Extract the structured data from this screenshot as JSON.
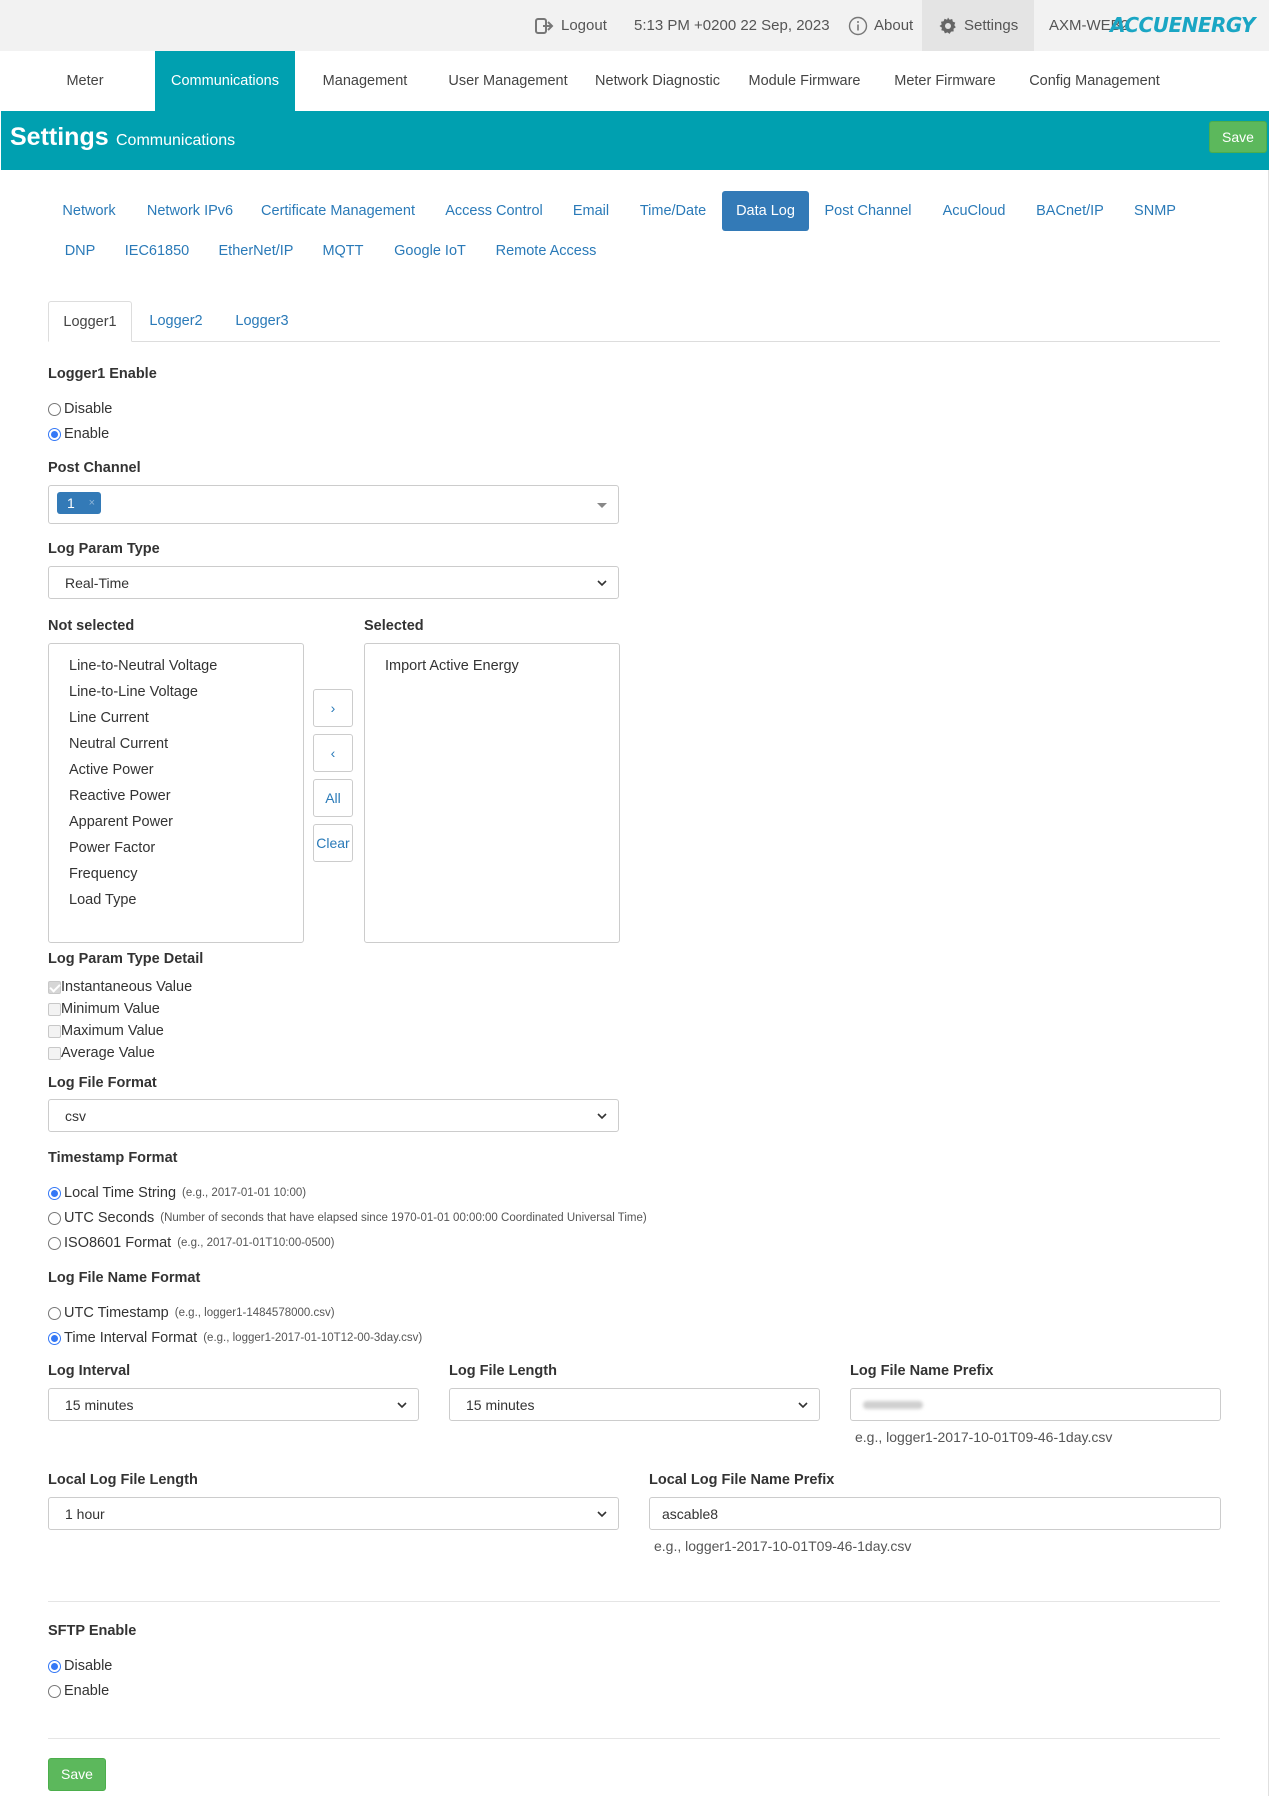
{
  "topbar": {
    "logout": "Logout",
    "datetime": "5:13 PM +0200 22 Sep, 2023",
    "about": "About",
    "settings": "Settings",
    "device": "AXM-WEB2",
    "logo": "ACCUENERGY"
  },
  "mainnav": [
    "Meter",
    "Communications",
    "Management",
    "User Management",
    "Network Diagnostic",
    "Module Firmware",
    "Meter Firmware",
    "Config Management"
  ],
  "header": {
    "title": "Settings",
    "subtitle": "Communications",
    "save": "Save"
  },
  "subtabs_row1": [
    "Network",
    "Network IPv6",
    "Certificate Management",
    "Access Control",
    "Email",
    "Time/Date",
    "Data Log",
    "Post Channel",
    "AcuCloud",
    "BACnet/IP",
    "SNMP"
  ],
  "subtabs_row2": [
    "DNP",
    "IEC61850",
    "EtherNet/IP",
    "MQTT",
    "Google IoT",
    "Remote Access"
  ],
  "active_subtab": "Data Log",
  "logger_tabs": [
    "Logger1",
    "Logger2",
    "Logger3"
  ],
  "logger_enable": {
    "label": "Logger1 Enable",
    "options": [
      "Disable",
      "Enable"
    ],
    "selected": "Enable"
  },
  "post_channel": {
    "label": "Post Channel",
    "tag": "1",
    "remove": "×"
  },
  "log_param_type": {
    "label": "Log Param Type",
    "value": "Real-Time"
  },
  "not_selected": {
    "label": "Not selected",
    "items": [
      "Line-to-Neutral Voltage",
      "Line-to-Line Voltage",
      "Line Current",
      "Neutral Current",
      "Active Power",
      "Reactive Power",
      "Apparent Power",
      "Power Factor",
      "Frequency",
      "Load Type"
    ]
  },
  "selected": {
    "label": "Selected",
    "items": [
      "Import Active Energy"
    ]
  },
  "move_buttons": {
    "right": "›",
    "left": "‹",
    "all": "All",
    "clear": "Clear"
  },
  "param_detail": {
    "label": "Log Param Type Detail",
    "options": [
      "Instantaneous Value",
      "Minimum Value",
      "Maximum Value",
      "Average Value"
    ],
    "checked": [
      "Instantaneous Value"
    ]
  },
  "file_format": {
    "label": "Log File Format",
    "value": "csv"
  },
  "timestamp_format": {
    "label": "Timestamp Format",
    "options": [
      {
        "name": "Local Time String",
        "hint": "(e.g., 2017-01-01 10:00)"
      },
      {
        "name": "UTC Seconds",
        "hint": "(Number of seconds that have elapsed since 1970-01-01 00:00:00 Coordinated Universal Time)"
      },
      {
        "name": "ISO8601 Format",
        "hint": "(e.g., 2017-01-01T10:00-0500)"
      }
    ],
    "selected": "Local Time String"
  },
  "filename_format": {
    "label": "Log File Name Format",
    "options": [
      {
        "name": "UTC Timestamp",
        "hint": "(e.g., logger1-1484578000.csv)"
      },
      {
        "name": "Time Interval Format",
        "hint": "(e.g., logger1-2017-01-10T12-00-3day.csv)"
      }
    ],
    "selected": "Time Interval Format"
  },
  "log_interval": {
    "label": "Log Interval",
    "value": "15 minutes"
  },
  "log_file_length": {
    "label": "Log File Length",
    "value": "15 minutes"
  },
  "log_file_prefix": {
    "label": "Log File Name Prefix",
    "note": "e.g., logger1-2017-10-01T09-46-1day.csv"
  },
  "local_file_length": {
    "label": "Local Log File Length",
    "value": "1 hour"
  },
  "local_file_prefix": {
    "label": "Local Log File Name Prefix",
    "value": "ascable8",
    "note": "e.g., logger1-2017-10-01T09-46-1day.csv"
  },
  "sftp": {
    "label": "SFTP Enable",
    "options": [
      "Disable",
      "Enable"
    ],
    "selected": "Disable"
  },
  "footer": {
    "save": "Save"
  }
}
